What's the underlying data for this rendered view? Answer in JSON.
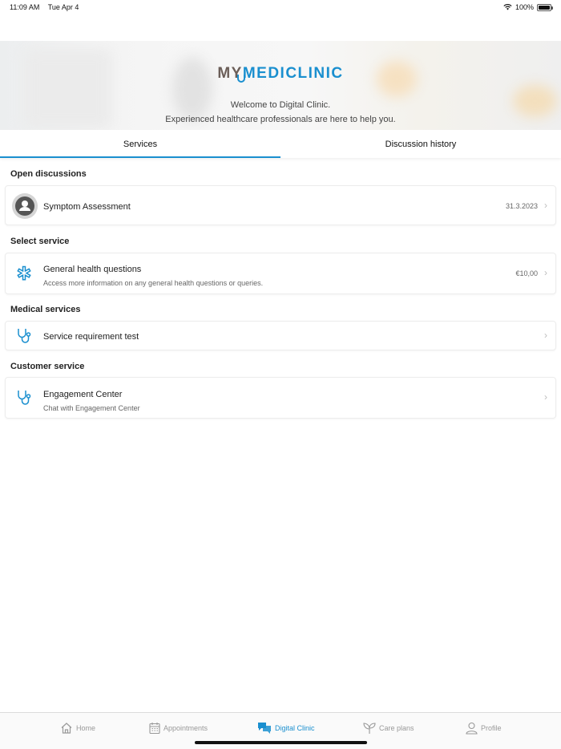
{
  "status": {
    "time": "11:09 AM",
    "date": "Tue Apr 4",
    "battery": "100%"
  },
  "hero": {
    "logo_my": "MY",
    "logo_medi": "MEDICLINIC",
    "welcome": "Welcome to Digital Clinic.",
    "subtitle": "Experienced healthcare professionals are here to help you."
  },
  "tabs": [
    {
      "label": "Services",
      "active": true
    },
    {
      "label": "Discussion history",
      "active": false
    }
  ],
  "sections": {
    "open": {
      "title": "Open discussions",
      "item": {
        "title": "Symptom Assessment",
        "date": "31.3.2023",
        "icon": "avatar-icon"
      }
    },
    "select": {
      "title": "Select service",
      "item": {
        "title": "General health questions",
        "subtitle": "Access more information on any general health questions or queries.",
        "price": "€10,00",
        "icon": "medical-star-icon"
      }
    },
    "medical": {
      "title": "Medical services",
      "item": {
        "title": "Service requirement test",
        "icon": "stethoscope-icon"
      }
    },
    "customer": {
      "title": "Customer service",
      "item": {
        "title": "Engagement Center",
        "subtitle": "Chat with Engagement Center",
        "icon": "stethoscope-icon"
      }
    }
  },
  "nav": [
    {
      "label": "Home",
      "icon": "home-icon",
      "active": false
    },
    {
      "label": "Appointments",
      "icon": "calendar-icon",
      "active": false
    },
    {
      "label": "Digital Clinic",
      "icon": "chat-icon",
      "active": true
    },
    {
      "label": "Care plans",
      "icon": "leaf-icon",
      "active": false
    },
    {
      "label": "Profile",
      "icon": "person-icon",
      "active": false
    }
  ],
  "colors": {
    "accent": "#1a8fcf",
    "logo_brown": "#6b5e58",
    "chevron": "#bdbdbd"
  }
}
